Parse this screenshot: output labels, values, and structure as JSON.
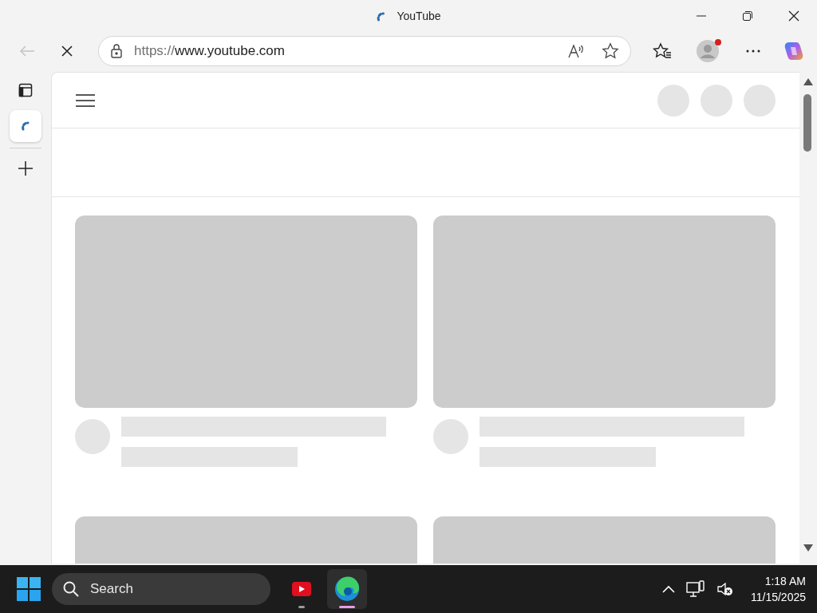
{
  "window": {
    "title": "YouTube",
    "loading": true
  },
  "toolbar": {
    "back_disabled": true,
    "url_scheme": "https://",
    "url_host": "www.youtube.com",
    "profile_notification": true
  },
  "tabs": [
    {
      "selected": true,
      "loading": true
    }
  ],
  "page_header": {
    "avatars": [
      {
        "kind": "placeholder"
      },
      {
        "kind": "placeholder"
      },
      {
        "kind": "placeholder"
      }
    ]
  },
  "feed": [
    {
      "kind": "placeholder"
    },
    {
      "kind": "placeholder"
    },
    {
      "kind": "thumbnail"
    },
    {
      "kind": "thumbnail"
    }
  ],
  "taskbar": {
    "search_placeholder": "Search",
    "apps": [
      {
        "kind": "youtube",
        "active": false
      },
      {
        "kind": "edge",
        "active": true
      }
    ],
    "volume_muted": true,
    "time": "1:18 AM",
    "date": "11/15/2025"
  }
}
